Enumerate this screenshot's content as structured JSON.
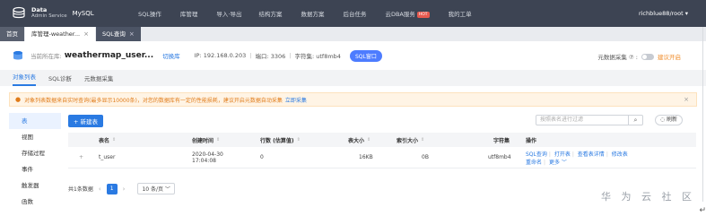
{
  "header": {
    "logo_line1": "Data",
    "logo_line2": "Admin Service",
    "logo_product": "MySQL",
    "nav": [
      "SQL操作",
      "库管理",
      "导入·导出",
      "结构方案",
      "数据方案",
      "后台任务",
      "云DBA服务",
      "我的工单"
    ],
    "hot_badge": "HOT",
    "user": "richblue88/root ▾"
  },
  "tabs": [
    {
      "label": "首页"
    },
    {
      "label": "库管理-weather...",
      "close": "×"
    },
    {
      "label": "SQL查询",
      "close": "×"
    }
  ],
  "dbinfo": {
    "current_label": "当前所在库:",
    "db_name": "weathermap_user...",
    "switch_link": "切换库",
    "ip": "IP: 192.168.0.203",
    "port": "端口: 3306",
    "charset": "字符集: utf8mb4",
    "sql_button": "SQL窗口",
    "collect_label": "元数据采集 ⑦ :",
    "collect_link": "建议开启"
  },
  "subtabs": [
    "对象列表",
    "SQL诊断",
    "元数据采集"
  ],
  "alert": {
    "text": "对象列表数据来自实时查询(最多显示10000条)，对您的数据库有一定的性能损耗，建议开启元数据自动采集",
    "link": "立即采集",
    "close": "×"
  },
  "sidebar": [
    "表",
    "视图",
    "存储过程",
    "事件",
    "触发器",
    "函数"
  ],
  "toolbar": {
    "new_button": "+ 新建表",
    "search_placeholder": "按照表名进行过滤",
    "refresh": "◌ 刷新"
  },
  "table": {
    "columns": [
      "表名",
      "创建时间",
      "行数 (估算值)",
      "表大小",
      "索引大小",
      "字符集",
      "操作"
    ],
    "rows": [
      {
        "expand": "+",
        "name": "t_user",
        "created_date": "2020-04-30",
        "created_time": "17:04:08",
        "rows": "0",
        "size": "16KB",
        "index_size": "0B",
        "charset": "utf8mb4",
        "ops_line1": [
          "SQL查询",
          "打开表",
          "查看表详情",
          "修改表"
        ],
        "ops_line2": [
          "重命名",
          "更多 ﹀"
        ]
      }
    ]
  },
  "pager": {
    "total": "共1条数据",
    "current_page": "1",
    "page_size": "10 条/页 ﹀"
  },
  "watermark": "华 为 云 社 区",
  "corner_mark": "↵"
}
